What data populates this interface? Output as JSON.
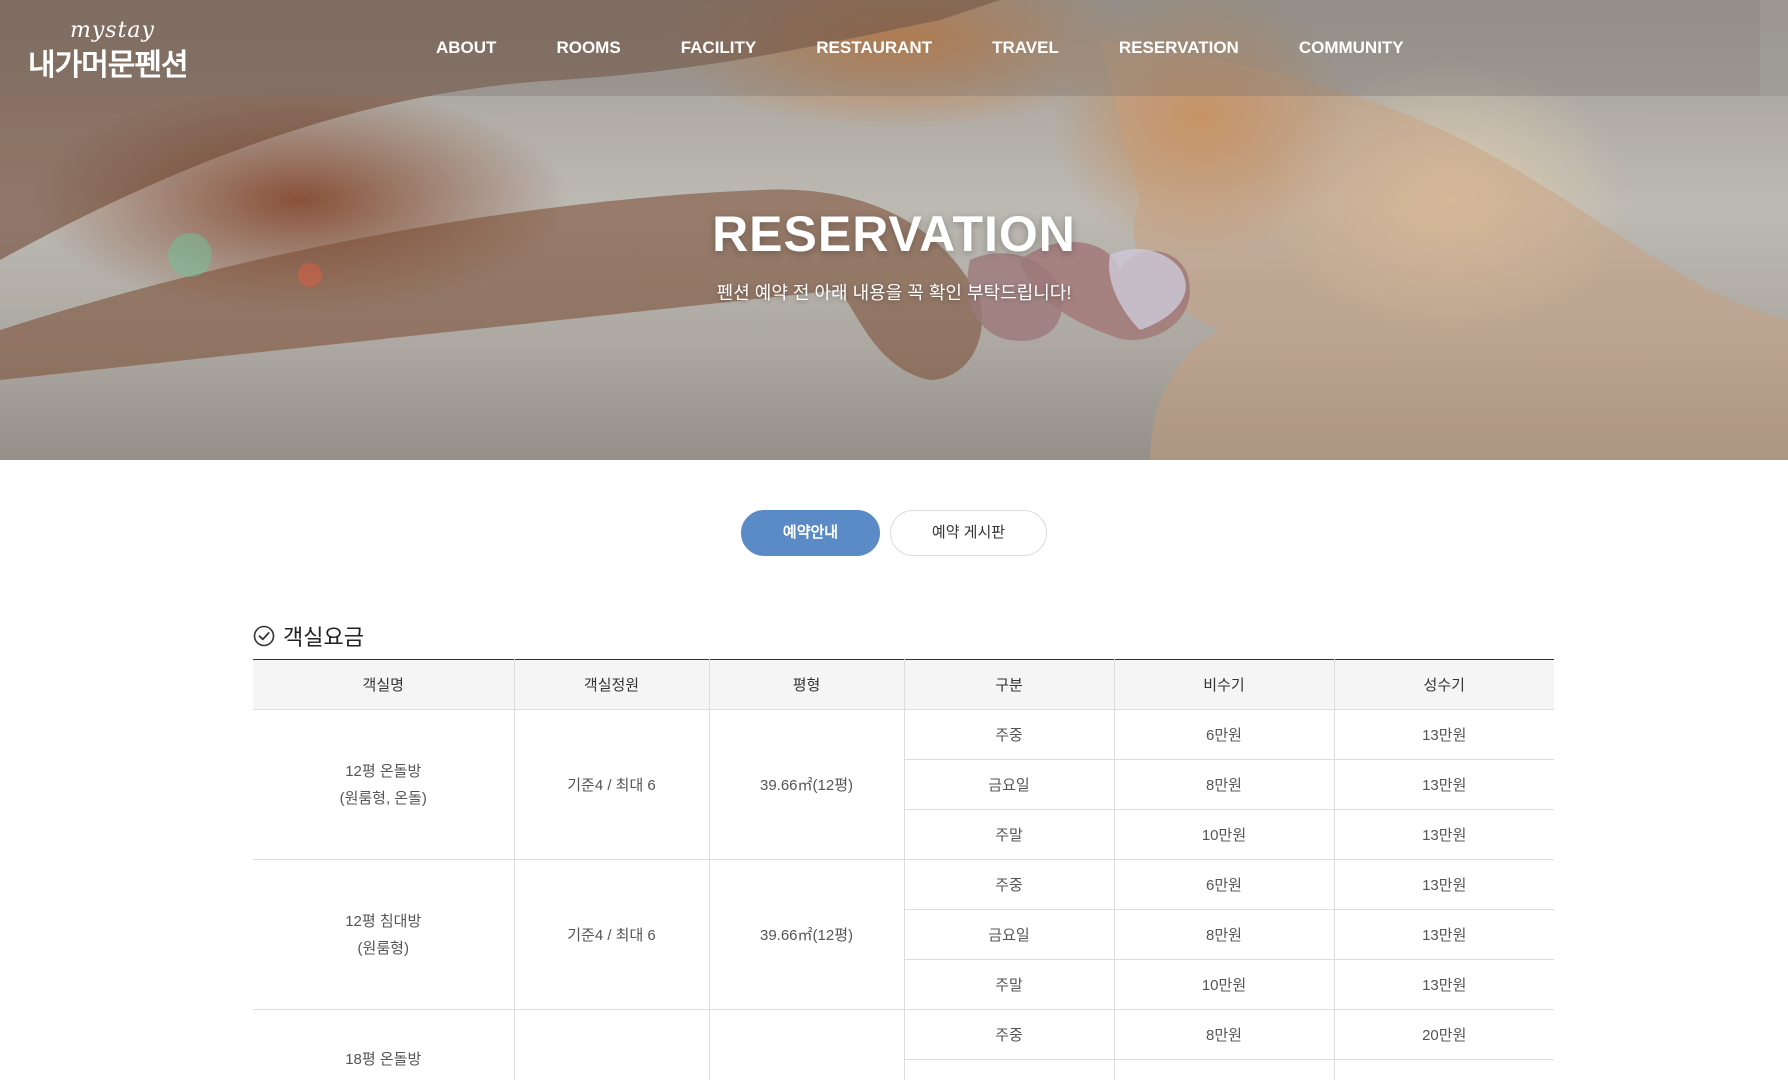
{
  "header": {
    "logo": {
      "top": "mystay",
      "main": "내가머문펜션"
    },
    "nav": [
      "ABOUT",
      "ROOMS",
      "FACILITY",
      "RESTAURANT",
      "TRAVEL",
      "RESERVATION",
      "COMMUNITY"
    ]
  },
  "hero": {
    "title": "RESERVATION",
    "subtitle": "펜션 예약 전 아래 내용을 꼭 확인 부탁드립니다!"
  },
  "tabs": {
    "active": "예약안내",
    "inactive": "예약 게시판"
  },
  "section": {
    "title": "객실요금"
  },
  "table": {
    "headers": [
      "객실명",
      "객실정원",
      "평형",
      "구분",
      "비수기",
      "성수기"
    ],
    "rooms": [
      {
        "name_line1": "12평 온돌방",
        "name_line2": "(원룸형, 온돌)",
        "capacity": "기준4 / 최대 6",
        "size": "39.66㎡(12평)",
        "rows": [
          {
            "period": "주중",
            "off": "6만원",
            "peak": "13만원"
          },
          {
            "period": "금요일",
            "off": "8만원",
            "peak": "13만원"
          },
          {
            "period": "주말",
            "off": "10만원",
            "peak": "13만원"
          }
        ]
      },
      {
        "name_line1": "12평 침대방",
        "name_line2": "(원룸형)",
        "capacity": "기준4 / 최대 6",
        "size": "39.66㎡(12평)",
        "rows": [
          {
            "period": "주중",
            "off": "6만원",
            "peak": "13만원"
          },
          {
            "period": "금요일",
            "off": "8만원",
            "peak": "13만원"
          },
          {
            "period": "주말",
            "off": "10만원",
            "peak": "13만원"
          }
        ]
      },
      {
        "name_line1": "18평 온돌방",
        "name_line2": "",
        "capacity": "",
        "size": "",
        "rows": [
          {
            "period": "주중",
            "off": "8만원",
            "peak": "20만원"
          }
        ]
      }
    ]
  }
}
